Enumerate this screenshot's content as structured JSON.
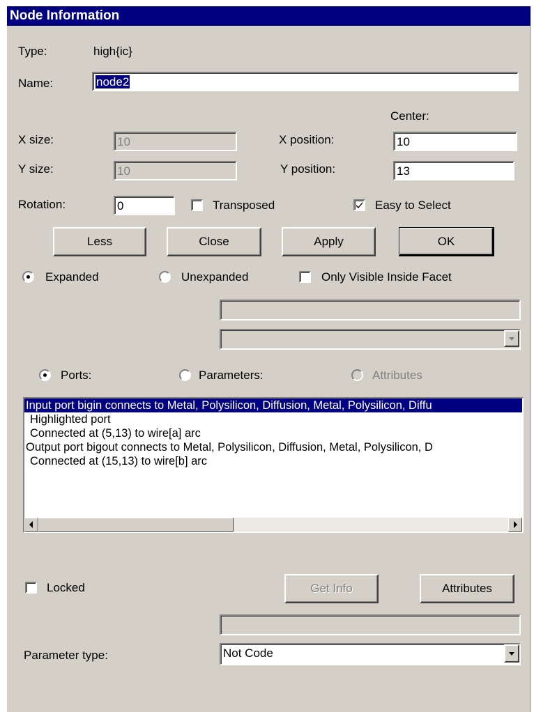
{
  "window": {
    "title": "Node Information"
  },
  "type": {
    "label": "Type:",
    "value": "high{ic}"
  },
  "name": {
    "label": "Name:",
    "value": "node2"
  },
  "center_label": "Center:",
  "size": {
    "x_label": "X size:",
    "x_value": "10",
    "y_label": "Y size:",
    "y_value": "10"
  },
  "position": {
    "x_label": "X position:",
    "x_value": "10",
    "y_label": "Y position:",
    "y_value": "13"
  },
  "rotation": {
    "label": "Rotation:",
    "value": "0"
  },
  "transposed": {
    "label": "Transposed",
    "checked": false
  },
  "easy_select": {
    "label": "Easy to Select",
    "checked": true
  },
  "buttons": {
    "less": "Less",
    "close": "Close",
    "apply": "Apply",
    "ok": "OK"
  },
  "expansion": {
    "expanded": "Expanded",
    "unexpanded": "Unexpanded",
    "selected": "expanded"
  },
  "only_visible": {
    "label": "Only Visible Inside Facet",
    "checked": false
  },
  "info_tabs": {
    "ports": "Ports:",
    "parameters": "Parameters:",
    "attributes": "Attributes",
    "selected": "ports"
  },
  "ports_list": [
    "Input port bigin connects to Metal, Polysilicon, Diffusion, Metal, Polysilicon, Diffu",
    "  Highlighted port",
    "  Connected at (5,13) to wire[a] arc",
    "Output port bigout connects to Metal, Polysilicon, Diffusion, Metal, Polysilicon, D",
    "  Connected at (15,13) to wire[b] arc"
  ],
  "locked": {
    "label": "Locked",
    "checked": false
  },
  "get_info_button": "Get Info",
  "attributes_button": "Attributes",
  "parameter_type": {
    "label": "Parameter type:",
    "value": "Not Code"
  }
}
